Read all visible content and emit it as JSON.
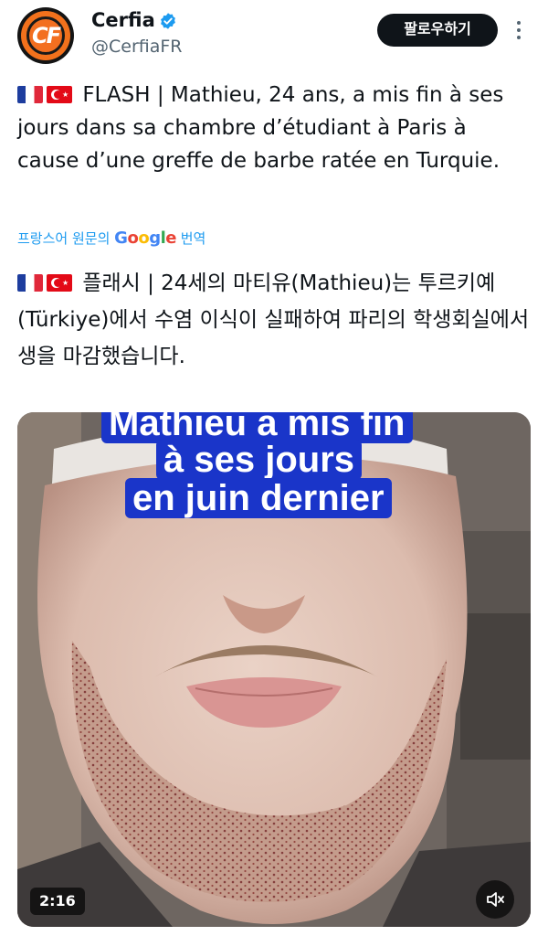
{
  "header": {
    "display_name": "Cerfia",
    "handle": "@CerfiaFR",
    "follow_label": "팔로우하기",
    "avatar_text": "CF"
  },
  "tweet": {
    "original_text": "FLASH | Mathieu, 24 ans, a mis fin à ses jours dans sa chambre d’étudiant à Paris à cause d’une greffe de barbe ratée en Turquie.",
    "translate_prefix": "프랑스어 원문의",
    "translate_google": [
      "G",
      "o",
      "o",
      "g",
      "l",
      "e"
    ],
    "translate_suffix": "번역",
    "translated_text": "플래시 | 24세의 마티유(Mathieu)는 투르키예(Türkiye)에서 수염 이식이 실패하여 파리의 학생회실에서 생을 마감했습니다.",
    "flags": [
      "flag-france-icon",
      "flag-turkey-icon"
    ]
  },
  "media": {
    "caption_lines": [
      "Mathieu a mis fin",
      "à ses jours",
      "en juin dernier"
    ],
    "duration": "2:16",
    "mute_icon": "speaker-muted-icon"
  },
  "colors": {
    "link": "#1d9bf0",
    "verified": "#1d9bf0",
    "follow_bg": "#0f1419",
    "caption_bg": "#1a35c9",
    "avatar_orange": "#f36f20"
  }
}
